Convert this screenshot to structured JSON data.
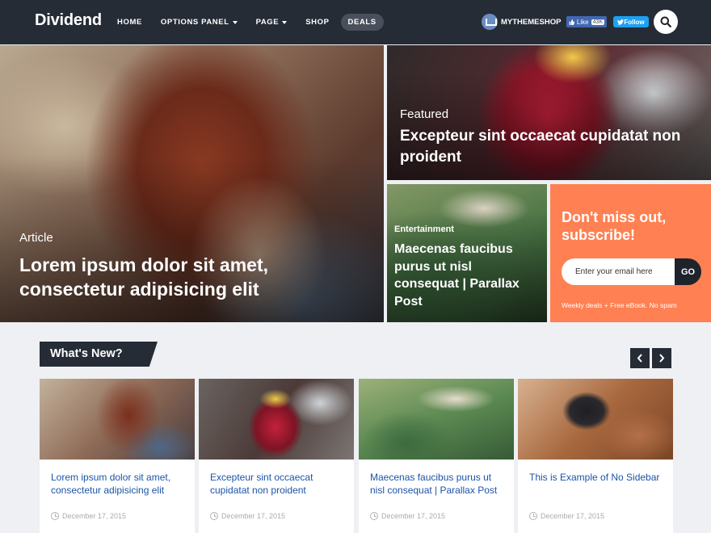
{
  "header": {
    "logo": "Dividend",
    "nav": [
      {
        "label": "HOME",
        "dropdown": false
      },
      {
        "label": "OPTIONS PANEL",
        "dropdown": true
      },
      {
        "label": "PAGE",
        "dropdown": true
      },
      {
        "label": "SHOP",
        "dropdown": false
      },
      {
        "label": "DEALS",
        "dropdown": false,
        "active": true
      }
    ],
    "brand": "MYTHEMESHOP",
    "fb_like": "Like",
    "fb_count": "43K",
    "twitter": "Follow",
    "search_icon": "search-icon"
  },
  "hero": {
    "main": {
      "category": "Article",
      "title": "Lorem ipsum dolor sit amet, consectetur adipisicing elit"
    },
    "featured": {
      "category": "Featured",
      "title": "Excepteur sint occaecat cupidatat non proident"
    },
    "entertainment": {
      "category": "Entertainment",
      "title": "Maecenas faucibus purus ut nisl consequat | Parallax Post"
    }
  },
  "subscribe": {
    "title": "Don't miss out, subscribe!",
    "placeholder": "Enter your email here",
    "button": "GO",
    "note": "Weekly deals + Free eBook. No spam"
  },
  "section": {
    "title": "What's New?",
    "prev_icon": "chevron-left-icon",
    "next_icon": "chevron-right-icon"
  },
  "cards": [
    {
      "title": "Lorem ipsum dolor sit amet, consectetur adipisicing elit",
      "date": "December 17, 2015"
    },
    {
      "title": "Excepteur sint occaecat cupidatat non proident",
      "date": "December 17, 2015"
    },
    {
      "title": "Maecenas faucibus purus ut nisl consequat | Parallax Post",
      "date": "December 17, 2015"
    },
    {
      "title": "This is Example of No Sidebar",
      "date": "December 17, 2015"
    }
  ],
  "colors": {
    "header_bg": "#262c36",
    "accent_orange": "#ff8052",
    "link_blue": "#1b54a8",
    "page_bg": "#eef0f3"
  }
}
